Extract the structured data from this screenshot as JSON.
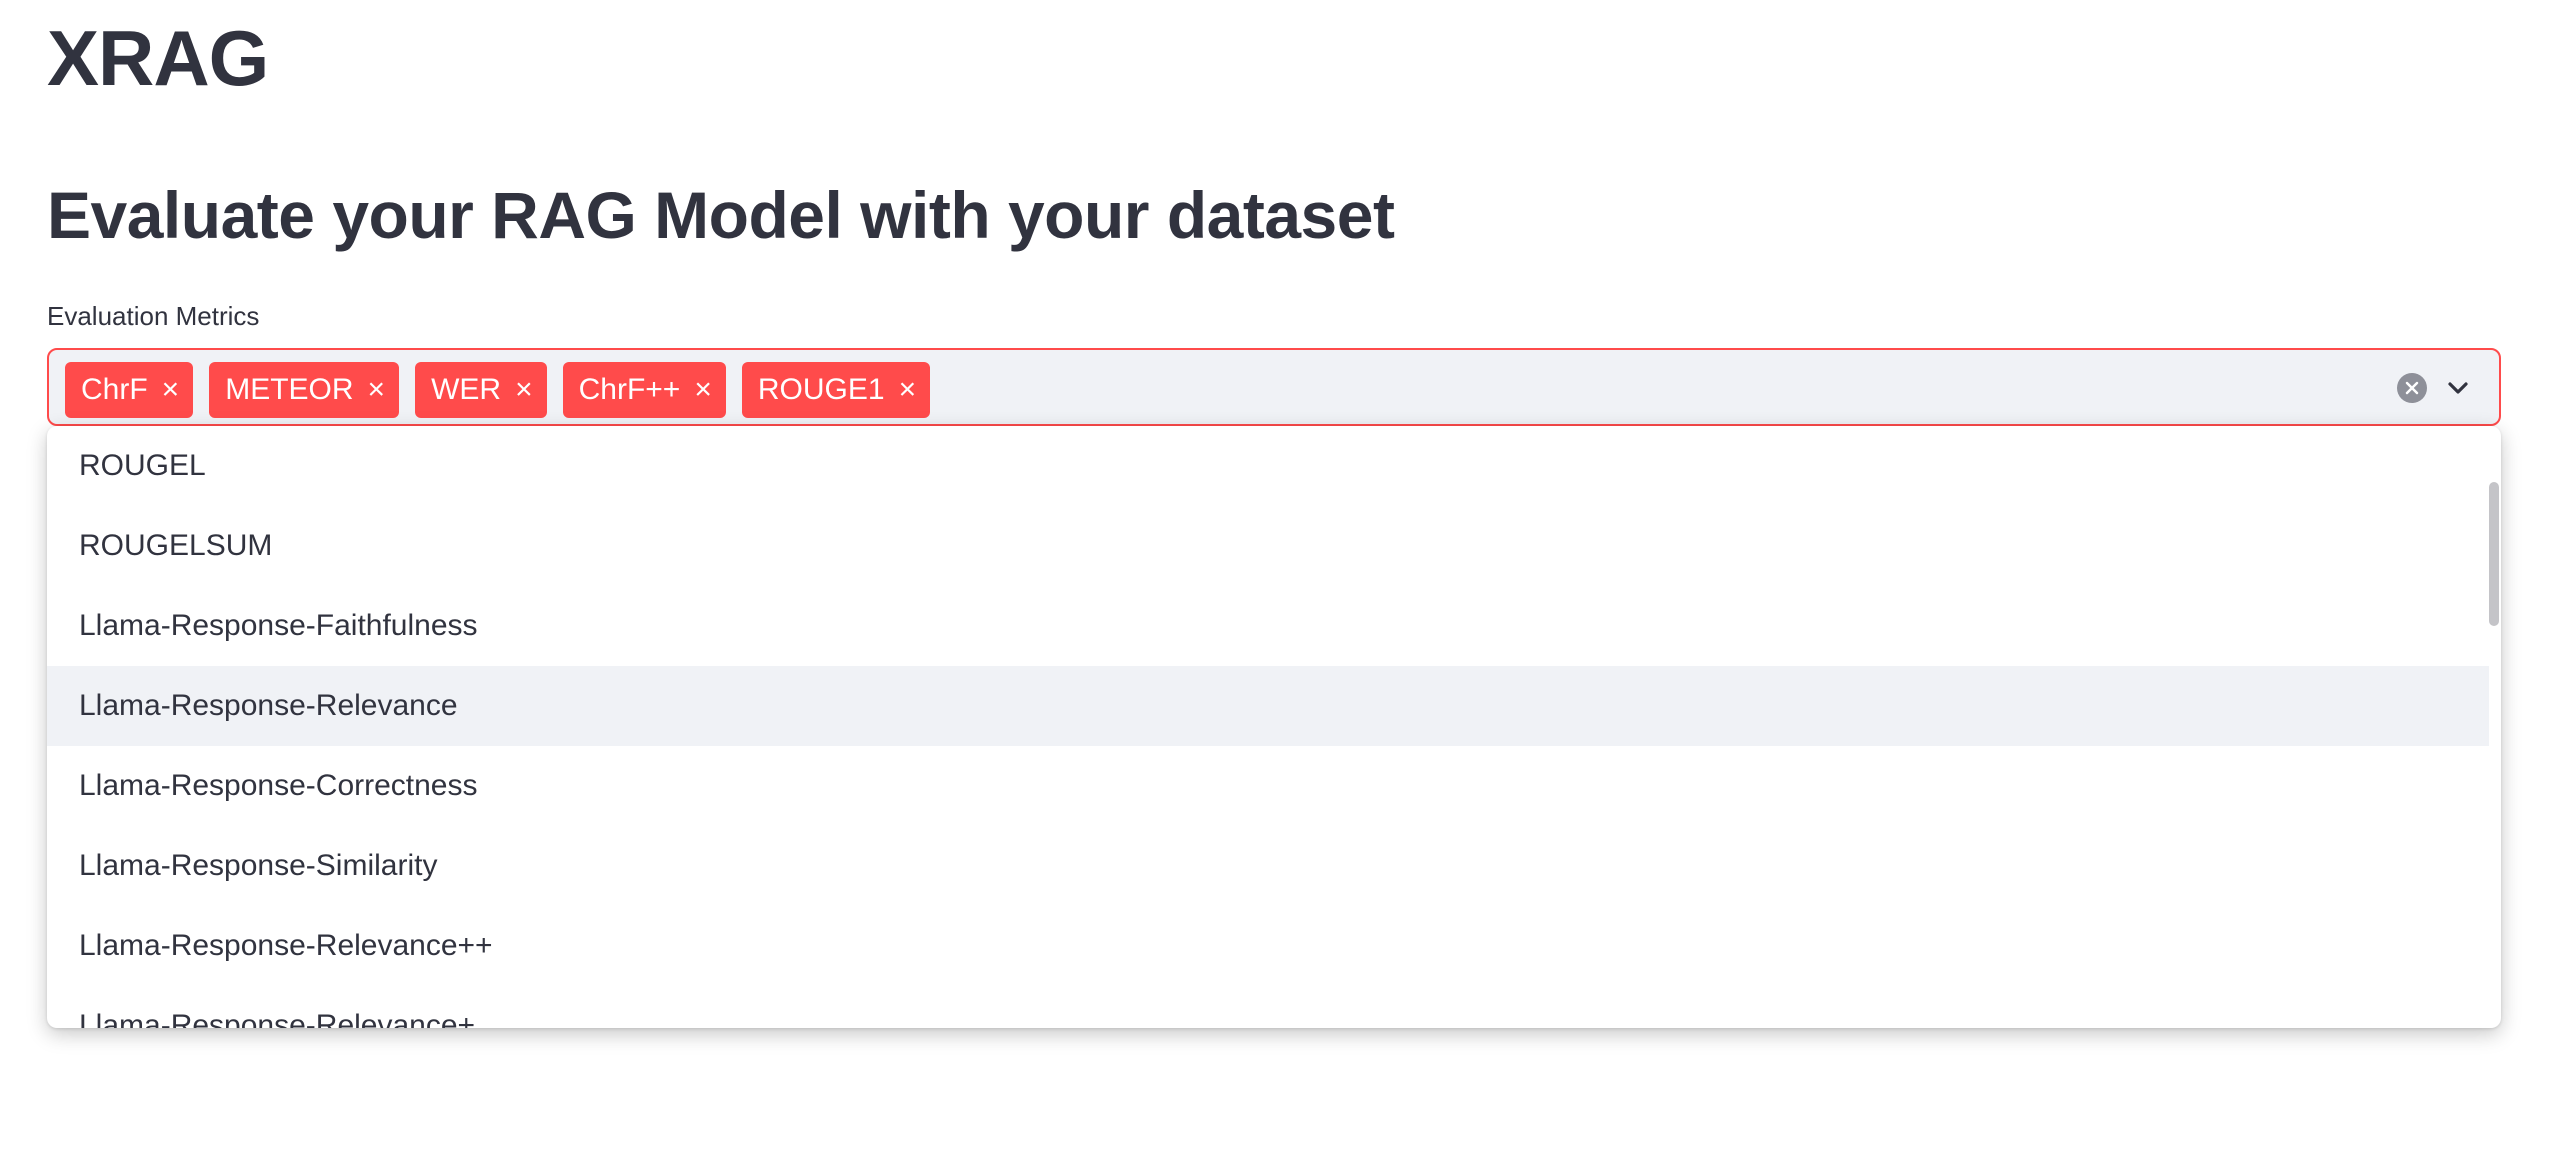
{
  "app": {
    "title": "XRAG"
  },
  "page": {
    "title": "Evaluate your RAG Model with your dataset"
  },
  "metrics_select": {
    "label": "Evaluation Metrics",
    "selected": [
      {
        "label": "ChrF",
        "remove": "×"
      },
      {
        "label": "METEOR",
        "remove": "×"
      },
      {
        "label": "WER",
        "remove": "×"
      },
      {
        "label": "ChrF++",
        "remove": "×"
      },
      {
        "label": "ROUGE1",
        "remove": "×"
      }
    ],
    "options": [
      "ROUGEL",
      "ROUGELSUM",
      "Llama-Response-Faithfulness",
      "Llama-Response-Relevance",
      "Llama-Response-Correctness",
      "Llama-Response-Similarity",
      "Llama-Response-Relevance++",
      "Llama-Response-Relevance+"
    ],
    "hovered_option_index": 3,
    "icons": {
      "clear": "clear-all-icon",
      "expand": "chevron-down-icon"
    }
  },
  "colors": {
    "accent": "#ff4b4b",
    "text": "#31333f",
    "input_bg": "#f0f2f6",
    "hover_bg": "#f0f2f6"
  }
}
